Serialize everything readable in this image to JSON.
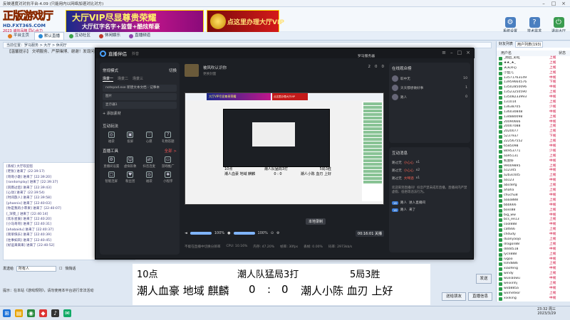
{
  "window": {
    "title": "反映速度对对抗平台-4.09 (只能用内以网络加速对比对方)"
  },
  "banner": {
    "logo_main": "正版游戏厅",
    "logo_site": "HD.FXT365.COM",
    "logo_slogan": "2023 诚信品牌 同心合力",
    "ad1_line1": "大厅VIP尽显尊贵荣耀",
    "ad1_line2": "大厅红字名字+监督+酷炫帮豪",
    "ad2_text": "点这里办理大厅VIP",
    "icons": [
      {
        "label": "系统设置",
        "icon": "gear-icon"
      },
      {
        "label": "技术需求",
        "icon": "help-icon"
      },
      {
        "label": "退出大厅",
        "icon": "exit-icon"
      }
    ]
  },
  "tabs": [
    {
      "label": "平台主页",
      "color": "#e07a1f"
    },
    {
      "label": "默认直播",
      "color": "#2a8ad4",
      "active": true
    },
    {
      "label": "互动社区",
      "color": "#3aa34a"
    },
    {
      "label": "休闲娱乐",
      "color": "#c0392b"
    },
    {
      "label": "直播频道",
      "color": "#8e44ad"
    }
  ],
  "address_bar": "当前位置：罗马服务 > 大厅 > 休闲厅",
  "marquee": "【温馨提示】 文明服务、严禁赌博、谢谢！发现问题请联系客服，欢迎大家踊跃参与……",
  "chat_lines": [
    "[系统] 大厅欢迎您",
    "[老张] 进来了 (22:39:17)",
    "[哥哥小歌] 进来了 [22:39:20]",
    "[randomplay] 进来了 [22:39:37]",
    "[风雨过后] 进来了 [22:39:43]",
    "[心动] 进来了 (22:39:54)",
    "[时间旅人] 进来了 [22:39:58]",
    "[phoenix] 进来了 [22:40:03]",
    "[你是我的小苹果] 进来了 [22:40:07]",
    "[_深夜_] 进来了 [22:40:14]",
    "[欢乐星辰] 进来了 [22:40:20]",
    "[小马哥哥] 进来了 [22:40:31]",
    "[ahabaidu] 进来了 [22:40:37]",
    "[简单快乐] 进来了 [22:40:39]",
    "[往事如风] 进来了 [22:40:45]",
    "[好运来来来] 进来了 [22:40:52]"
  ],
  "send_row": {
    "target_label": "发送给",
    "target_value": "所有人",
    "private_label": "悄悄话",
    "send_label": "发送"
  },
  "status_line": "提示：在本站《游戏规则》，请勿使用本平台进行非法活动",
  "bottom_buttons": [
    "送给朋友",
    "直播信息",
    "电子签名"
  ],
  "right_panel": {
    "tabs": [
      "好友列表",
      "用户列表(193)"
    ],
    "col_user": "用户名",
    "col_status": "状态",
    "users": [
      {
        "name": "_雨后_彩虹",
        "tag": "上线"
      },
      {
        "name": "★★_★_",
        "tag": "上线"
      },
      {
        "name": "天天开心",
        "tag": "上线"
      },
      {
        "name": "小鱼儿",
        "tag": "上线"
      },
      {
        "name": "13571763149",
        "tag": "中线"
      },
      {
        "name": "13959664576",
        "tag": "下线"
      },
      {
        "name": "13502850096",
        "tag": "中线"
      },
      {
        "name": "13523250590",
        "tag": "上线"
      },
      {
        "name": "13508233993",
        "tag": "中线"
      },
      {
        "name": "131014",
        "tag": "上线"
      },
      {
        "name": "13638705",
        "tag": "少线"
      },
      {
        "name": "136030848",
        "tag": "中线"
      },
      {
        "name": "134880098",
        "tag": "上线"
      },
      {
        "name": "20090666",
        "tag": "中线"
      },
      {
        "name": "20007088",
        "tag": "上线"
      },
      {
        "name": "2020077",
        "tag": "上线"
      },
      {
        "name": "5237937",
        "tag": "下线"
      },
      {
        "name": "222567552",
        "tag": "上线"
      },
      {
        "name": "6585098",
        "tag": "中线"
      },
      {
        "name": "84953771",
        "tag": "少线"
      },
      {
        "name": "aa95131",
        "tag": "上线"
      },
      {
        "name": "机会好",
        "tag": "中线"
      },
      {
        "name": "99009895",
        "tag": "上线"
      },
      {
        "name": "a12345",
        "tag": "中线"
      },
      {
        "name": "a2b3c4d5",
        "tag": "上线"
      },
      {
        "name": "aa123",
        "tag": "中线"
      },
      {
        "name": "abcdefg",
        "tag": "上线"
      },
      {
        "name": "ahaha",
        "tag": "上线"
      },
      {
        "name": "chuchu8",
        "tag": "中线"
      },
      {
        "name": "aaaa888",
        "tag": "上线"
      },
      {
        "name": "bbb666",
        "tag": "中线"
      },
      {
        "name": "boss88",
        "tag": "上线"
      },
      {
        "name": "big_ww",
        "tag": "中线"
      },
      {
        "name": "bcs_ee13",
        "tag": "上线"
      },
      {
        "name": "cool888",
        "tag": "中线"
      },
      {
        "name": "cat666",
        "tag": "上线"
      },
      {
        "name": "chdudy",
        "tag": "中线"
      },
      {
        "name": "duanyaojo",
        "tag": "上线"
      },
      {
        "name": "dragon88",
        "tag": "上线"
      },
      {
        "name": "dddd518",
        "tag": "中线"
      },
      {
        "name": "lycn888",
        "tag": "上线"
      },
      {
        "name": "ivgoo",
        "tag": "中线"
      },
      {
        "name": "lsmd886",
        "tag": "上线"
      },
      {
        "name": "xiaofeng",
        "tag": "中线"
      },
      {
        "name": "windy",
        "tag": "上线"
      },
      {
        "name": "wuxiaowu",
        "tag": "中线"
      },
      {
        "name": "weixinhj",
        "tag": "上线"
      },
      {
        "name": "wxb885a",
        "tag": "中线"
      },
      {
        "name": "wxmeteor",
        "tag": "上线"
      },
      {
        "name": "xixiking",
        "tag": "中线"
      }
    ]
  },
  "taskbar": {
    "time": "23:32 周三",
    "date": "2023/3/29"
  },
  "overlay": {
    "title": "直播伴侣",
    "subtitle": "抖音",
    "scene_section": "常规模式",
    "scene_toggle": "切换",
    "scene_tabs": [
      "场景一",
      "场景二",
      "场景三"
    ],
    "sources": [
      "notepad.exe 新建文本文档 - 记事本",
      "图片",
      "显示器1"
    ],
    "add_source": "+ 添加素材",
    "interact_section": "互动玩法",
    "interact_items": [
      "福袋",
      "投屏",
      "心愿",
      "礼物答题"
    ],
    "tools_section": "直播工具",
    "tools_more": "全部 >",
    "tools_items": [
      "直播间设置",
      "虚拟形象",
      "抖音连麦",
      "游戏推广",
      "智能连屏",
      "粉丝团",
      "福袋",
      "小程序"
    ],
    "room_name": "被风吹认识你",
    "room_cover": "更换封面",
    "room_stats": [
      "2",
      "0",
      "0"
    ],
    "live_badge": "罗马服务器",
    "volume_label": "100%",
    "mic_label": "100%",
    "duration": "00:16:01",
    "end_label": "关播",
    "local_record": "本地录制",
    "status_items": [
      "CPU: 10.16%",
      "内存: 47.20%",
      "帧率: 30fps",
      "丢帧: 0.00%",
      "码率: 2973kb/s"
    ],
    "status_hint": "不能在直播中切换分辨率",
    "audience_title": "在线观众榜",
    "audience": [
      {
        "name": "取中无",
        "count": "10"
      },
      {
        "name": "天天都想做好事",
        "count": "1"
      },
      {
        "name": "路人",
        "count": "0"
      }
    ],
    "interact_title": "互动消息",
    "gifts": [
      {
        "user": "路过无",
        "gift": "小心心",
        "count": "x1"
      },
      {
        "user": "路过无",
        "gift": "小心心",
        "count": "x2"
      },
      {
        "user": "路过无",
        "gift": "大啤酒",
        "count": "x1"
      }
    ],
    "notice": "欢迎来到直播间！抖音严禁未成年直播，直播间内严禁虚假、低俗等违法行为。",
    "messages": [
      {
        "level": "18",
        "user": "路人",
        "text": "进入直播间"
      },
      {
        "level": "18",
        "user": "路人",
        "text": "来了"
      }
    ],
    "preview_lines": [
      [
        "10点",
        "潮人队猛局3打",
        "5局3胜"
      ],
      [
        "潮人血豪 地域 麒麟",
        "0 : 0",
        "潮人小陈 血刃 上好"
      ]
    ]
  },
  "score": {
    "row1_time": "10点",
    "row1_mid": "潮人队猛局3打",
    "row1_right": "5局3胜",
    "row2_left": "潮人血豪 地域 麒麟",
    "row2_score_left": "0",
    "row2_colon": ":",
    "row2_score_right": "0",
    "row2_right": "潮人小陈 血刃 上好"
  }
}
